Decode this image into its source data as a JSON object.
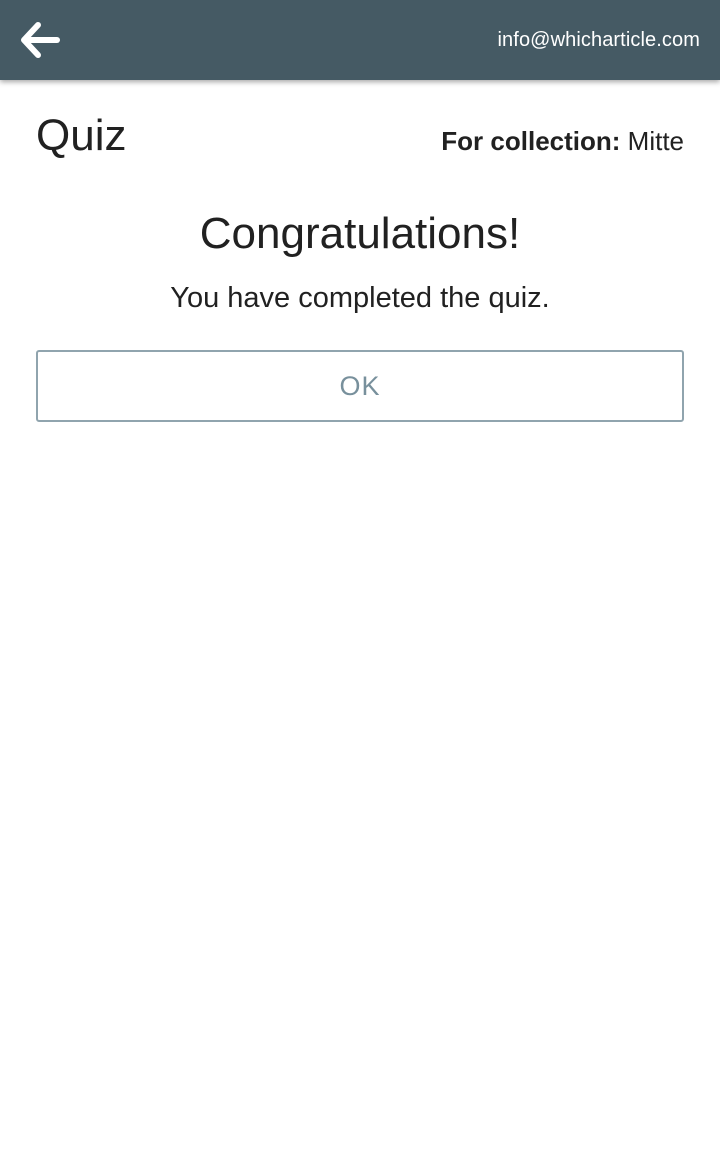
{
  "header": {
    "back_icon": "arrow-left-icon",
    "email": "info@whicharticle.com",
    "background_color": "#455a64"
  },
  "main": {
    "title": "Quiz",
    "collection_label": "For collection:",
    "collection_name": "Mitte",
    "congrats_heading": "Congratulations!",
    "completed_message": "You have completed the quiz.",
    "ok_label": "OK",
    "ok_border_color": "#90a4ae"
  }
}
